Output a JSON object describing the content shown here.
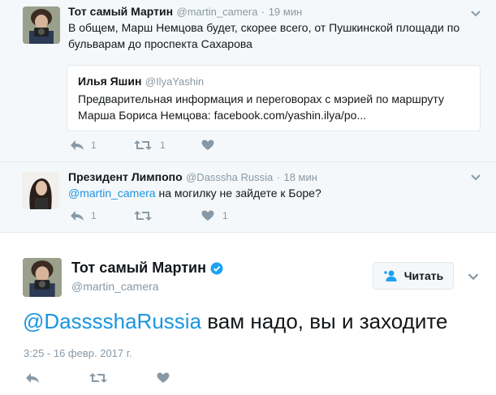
{
  "tweet1": {
    "name": "Тот самый Мартин",
    "handle": "@martin_camera",
    "dot": "·",
    "time": "19 мин",
    "text_line1": "В общем, Марш Немцова будет, скорее всего, от Пушкинской площади по",
    "text_line2": "бульварам до проспекта Сахарова",
    "quote": {
      "name": "Илья Яшин",
      "handle": "@IlyaYashin",
      "line1": "Предварительная информация и переговорах с мэрией по маршруту",
      "line2": "Марша Бориса Немцова: facebook.com/yashin.ilya/po..."
    },
    "reply_count": "1",
    "retweet_count": "1",
    "like_count": ""
  },
  "tweet2": {
    "name": "Президент Лимпопо",
    "handle": "@Dasssha Russia",
    "dot": "·",
    "time": "18 мин",
    "mention": "@martin_camera",
    "text": " на могилку не зайдете к Боре?",
    "reply_count": "1",
    "retweet_count": "",
    "like_count": "1"
  },
  "main": {
    "name": "Тот самый Мартин",
    "handle": "@martin_camera",
    "follow_label": "Читать",
    "mention": "@DasssshaRussia",
    "text": " вам надо, вы и заходите",
    "timestamp": "3:25 - 16 февр. 2017 г."
  },
  "icons": [
    "chevron-down-icon",
    "reply-icon",
    "retweet-icon",
    "heart-icon",
    "verified-icon",
    "follow-user-icon"
  ],
  "colors": {
    "accent": "#1b95e0",
    "muted": "#8899a6",
    "bg_conversation": "#f5f8fa",
    "border": "#e1e8ed"
  }
}
